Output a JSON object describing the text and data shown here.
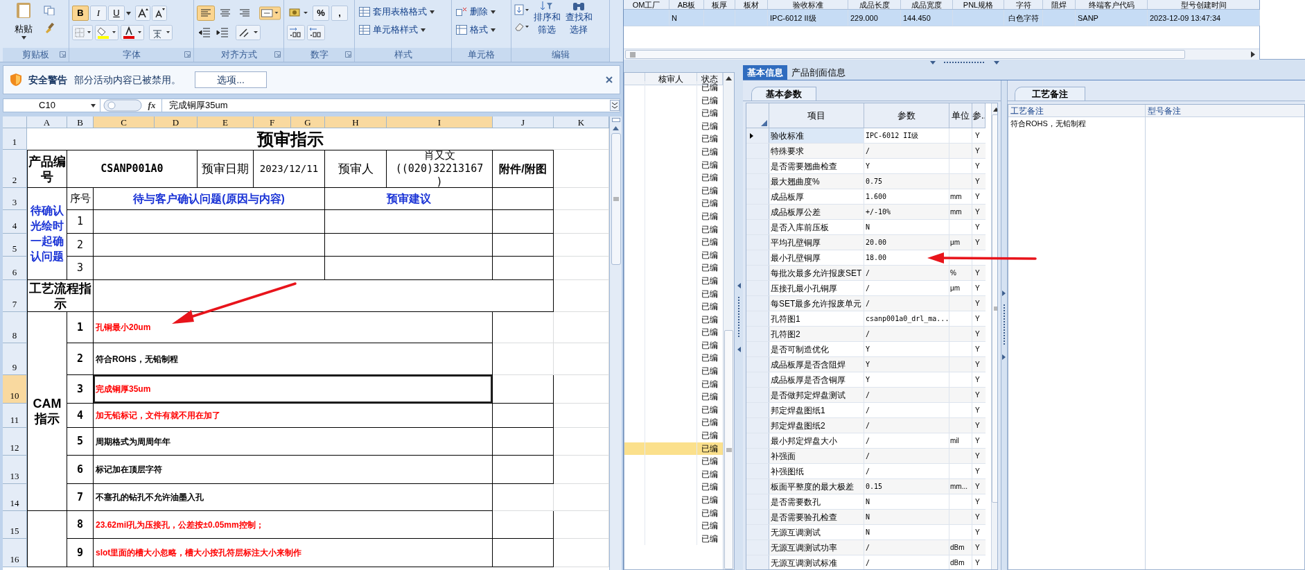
{
  "excel": {
    "ribbon": {
      "paste": "粘贴",
      "font_buttons": [
        {
          "label": "B",
          "on": true
        },
        {
          "label": "I",
          "on": false
        },
        {
          "label": "U",
          "on": false
        }
      ],
      "number_buttons": [
        "%",
        ","
      ],
      "style_buttons": [
        "套用表格格式",
        "单元格样式"
      ],
      "cell_buttons": [
        "删除",
        "格式"
      ],
      "edit_buttons": [
        "排序和筛选",
        "查找和选择"
      ],
      "groups": [
        "剪贴板",
        "字体",
        "对齐方式",
        "数字",
        "样式",
        "单元格",
        "编辑"
      ]
    },
    "security_bar": {
      "title": "安全警告",
      "message": "部分活动内容已被禁用。",
      "button": "选项..."
    },
    "formula_bar": {
      "name_box": "C10",
      "function_label": "fx",
      "formula": "完成铜厚35um"
    },
    "columns": [
      {
        "label": "A",
        "selected": false
      },
      {
        "label": "B",
        "selected": false
      },
      {
        "label": "C",
        "selected": true
      },
      {
        "label": "D",
        "selected": true
      },
      {
        "label": "E",
        "selected": true
      },
      {
        "label": "F",
        "selected": true
      },
      {
        "label": "G",
        "selected": true
      },
      {
        "label": "H",
        "selected": true
      },
      {
        "label": "I",
        "selected": true
      },
      {
        "label": "J",
        "selected": false
      },
      {
        "label": "K",
        "selected": false
      }
    ],
    "rows": [
      {
        "label": "1",
        "selected": false
      },
      {
        "label": "2",
        "selected": false
      },
      {
        "label": "3",
        "selected": false
      },
      {
        "label": "4",
        "selected": false
      },
      {
        "label": "5",
        "selected": false
      },
      {
        "label": "6",
        "selected": false
      },
      {
        "label": "7",
        "selected": false
      },
      {
        "label": "8",
        "selected": false
      },
      {
        "label": "9",
        "selected": false
      },
      {
        "label": "10",
        "selected": true
      },
      {
        "label": "11",
        "selected": false
      },
      {
        "label": "12",
        "selected": false
      },
      {
        "label": "13",
        "selected": false
      },
      {
        "label": "14",
        "selected": false
      },
      {
        "label": "15",
        "selected": false
      },
      {
        "label": "16",
        "selected": false
      }
    ],
    "form": {
      "title": "预审指示",
      "product_label": "产品编号",
      "product_no": "CSANP001A0",
      "date_label": "预审日期",
      "date": "2023/12/11",
      "reviewer_label": "预审人",
      "reviewer": "肖又文\n((020)32213167\n)",
      "attachment_label": "附件/附图",
      "pending_label": "待确认光绘时一起确认问题",
      "no_header": "序号",
      "question_header": "待与客户确认问题(原因与内容)",
      "advice_header": "预审建议",
      "pending_rows": [
        "1",
        "2",
        "3"
      ],
      "process_label": "工艺流程指示",
      "cam_label": "CAM指示",
      "instructions": [
        {
          "no": "1",
          "text": "孔铜最小20um",
          "color": "#ff0000",
          "selected": false
        },
        {
          "no": "2",
          "text": "符合ROHS，无铅制程",
          "color": "#000000",
          "selected": false
        },
        {
          "no": "3",
          "text": "完成铜厚35um",
          "color": "#ff0000",
          "selected": true
        },
        {
          "no": "4",
          "text": "加无铅标记，文件有就不用在加了",
          "color": "#ff0000",
          "selected": false
        },
        {
          "no": "5",
          "text": "周期格式为周周年年",
          "color": "#000000",
          "selected": false
        },
        {
          "no": "6",
          "text": "标记加在顶层字符",
          "color": "#000000",
          "selected": false
        },
        {
          "no": "7",
          "text": "不塞孔的钻孔不允许油墨入孔",
          "color": "#000000",
          "selected": false
        },
        {
          "no": "8",
          "text": "23.62mil孔为压接孔，公差按±0.05mm控制；",
          "color": "#ff0000",
          "selected": false
        },
        {
          "no": "9",
          "text": "slot里面的槽大小忽略，槽大小按孔符层标注大小来制作",
          "color": "#ff0000",
          "selected": false
        }
      ]
    }
  },
  "top_grid": {
    "columns": [
      "OM工厂",
      "AB板",
      "板厚",
      "板材",
      "验收标准",
      "成品长度",
      "成品宽度",
      "PNL规格",
      "字符",
      "阻焊",
      "终端客户代码",
      "型号创建时间"
    ],
    "rows": [
      {
        "selected": true,
        "cells": [
          null,
          "N",
          null,
          null,
          "IPC-6012 II级",
          "229.000",
          "144.450",
          null,
          "白色字符",
          null,
          "SANP",
          "2023-12-09 13:47:34"
        ]
      }
    ]
  },
  "list_panel": {
    "columns": [
      "核审人",
      "状态"
    ],
    "rows": [
      {
        "status": "已编",
        "selected": false
      },
      {
        "status": "已编",
        "selected": false
      },
      {
        "status": "已编",
        "selected": false
      },
      {
        "status": "已编",
        "selected": false
      },
      {
        "status": "已编",
        "selected": false
      },
      {
        "status": "已编",
        "selected": false
      },
      {
        "status": "已编",
        "selected": false
      },
      {
        "status": "已编",
        "selected": false
      },
      {
        "status": "已编",
        "selected": false
      },
      {
        "status": "已编",
        "selected": false
      },
      {
        "status": "已编",
        "selected": false
      },
      {
        "status": "已编",
        "selected": false
      },
      {
        "status": "已编",
        "selected": false
      },
      {
        "status": "已编",
        "selected": false
      },
      {
        "status": "已编",
        "selected": false
      },
      {
        "status": "已编",
        "selected": false
      },
      {
        "status": "已编",
        "selected": false
      },
      {
        "status": "已编",
        "selected": false
      },
      {
        "status": "已编",
        "selected": false
      },
      {
        "status": "已编",
        "selected": false
      },
      {
        "status": "已编",
        "selected": false
      },
      {
        "status": "已编",
        "selected": false
      },
      {
        "status": "已编",
        "selected": false
      },
      {
        "status": "已编",
        "selected": false
      },
      {
        "status": "已编",
        "selected": false
      },
      {
        "status": "已编",
        "selected": false
      },
      {
        "status": "已编",
        "selected": false
      },
      {
        "status": "已编",
        "selected": false
      },
      {
        "status": "已编",
        "selected": true
      },
      {
        "status": "已编",
        "selected": false
      },
      {
        "status": "已编",
        "selected": false
      },
      {
        "status": "已编",
        "selected": false
      },
      {
        "status": "已编",
        "selected": false
      },
      {
        "status": "已编",
        "selected": false
      },
      {
        "status": "已编",
        "selected": false
      },
      {
        "status": "已编",
        "selected": false
      }
    ]
  },
  "tabs": [
    {
      "label": "基本信息",
      "selected": true
    },
    {
      "label": "产品剖面信息",
      "selected": false
    }
  ],
  "params_panel": {
    "tab": "基本参数",
    "columns": [
      "项目",
      "参数",
      "单位",
      "参.."
    ],
    "rows": [
      {
        "item": "验收标准",
        "value": "IPC-6012 II级",
        "flag": "Y",
        "selected": true
      },
      {
        "item": "特殊要求",
        "value": "/",
        "flag": "Y",
        "selected": false
      },
      {
        "item": "是否需要翘曲检查",
        "value": "Y",
        "flag": "Y",
        "selected": false
      },
      {
        "item": "最大翘曲度%",
        "value": "0.75",
        "flag": "Y",
        "selected": false
      },
      {
        "item": "成品板厚",
        "value": "1.600",
        "unit": "mm",
        "flag": "Y",
        "selected": false
      },
      {
        "item": "成品板厚公差",
        "value": "+/-10%",
        "unit": "mm",
        "flag": "Y",
        "selected": false
      },
      {
        "item": "是否入库前压板",
        "value": "N",
        "flag": "Y",
        "selected": false
      },
      {
        "item": "平均孔壁铜厚",
        "value": "20.00",
        "unit": "μm",
        "flag": "Y",
        "selected": false
      },
      {
        "item": "最小孔壁铜厚",
        "value": "18.00",
        "selected": false
      },
      {
        "item": "每批次最多允许报废SET",
        "value": "/",
        "unit": "%",
        "flag": "Y",
        "selected": false
      },
      {
        "item": "压接孔最小孔铜厚",
        "value": "/",
        "unit": "μm",
        "flag": "Y",
        "selected": false
      },
      {
        "item": "每SET最多允许报废单元",
        "value": "/",
        "flag": "Y",
        "selected": false
      },
      {
        "item": "孔符图1",
        "value": "csanp001a0_drl_ma...",
        "flag": "Y",
        "selected": false
      },
      {
        "item": "孔符图2",
        "value": "/",
        "flag": "Y",
        "selected": false
      },
      {
        "item": "是否可制造优化",
        "value": "Y",
        "flag": "Y",
        "selected": false
      },
      {
        "item": "成品板厚是否含阻焊",
        "value": "Y",
        "flag": "Y",
        "selected": false
      },
      {
        "item": "成品板厚是否含铜厚",
        "value": "Y",
        "flag": "Y",
        "selected": false
      },
      {
        "item": "是否做邦定焊盘测试",
        "value": "/",
        "flag": "Y",
        "selected": false
      },
      {
        "item": "邦定焊盘图纸1",
        "value": "/",
        "flag": "Y",
        "selected": false
      },
      {
        "item": "邦定焊盘图纸2",
        "value": "/",
        "flag": "Y",
        "selected": false
      },
      {
        "item": "最小邦定焊盘大小",
        "value": "/",
        "unit": "mil",
        "flag": "Y",
        "selected": false
      },
      {
        "item": "补强面",
        "value": "/",
        "flag": "Y",
        "selected": false
      },
      {
        "item": "补强图纸",
        "value": "/",
        "flag": "Y",
        "selected": false
      },
      {
        "item": "板面平整度的最大极差",
        "value": "0.15",
        "unit": "mm...",
        "flag": "Y",
        "selected": false
      },
      {
        "item": "是否需要数孔",
        "value": "N",
        "flag": "Y",
        "selected": false
      },
      {
        "item": "是否需要验孔检查",
        "value": "N",
        "flag": "Y",
        "selected": false
      },
      {
        "item": "无源互调测试",
        "value": "N",
        "flag": "Y",
        "selected": false
      },
      {
        "item": "无源互调测试功率",
        "value": "/",
        "unit": "dBm",
        "flag": "Y",
        "selected": false
      },
      {
        "item": "无源互调测试标准",
        "value": "/",
        "unit": "dBm",
        "flag": "Y",
        "selected": false
      }
    ]
  },
  "memo_panel": {
    "tab": "工艺备注",
    "columns": [
      "工艺备注",
      "型号备注"
    ],
    "process_note": "符合ROHS，无铅制程"
  }
}
